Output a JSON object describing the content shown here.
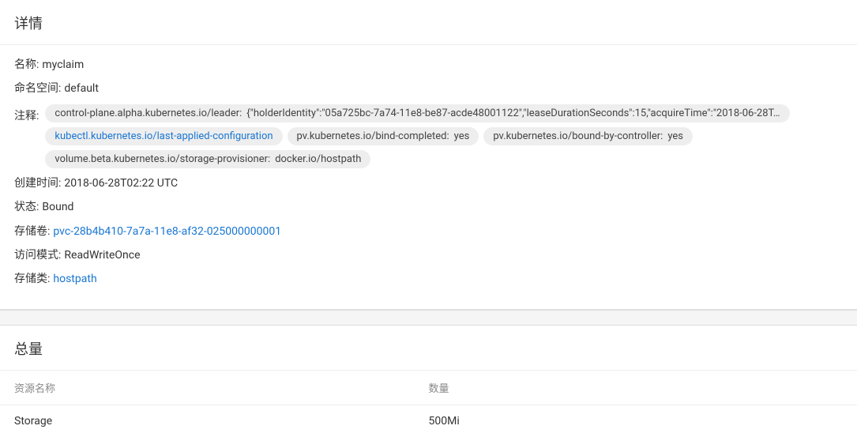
{
  "details": {
    "title": "详情",
    "name_label": "名称:",
    "name_value": "myclaim",
    "namespace_label": "命名空间:",
    "namespace_value": "default",
    "annotations_label": "注释:",
    "annotations": [
      {
        "key": "control-plane.alpha.kubernetes.io/leader:",
        "value": "{\"holderIdentity\":\"05a725bc-7a74-11e8-be87-acde48001122\",\"leaseDurationSeconds\":15,\"acquireTime\":\"2018-06-28T…",
        "link": false,
        "has_value": true
      },
      {
        "key": "kubectl.kubernetes.io/last-applied-configuration",
        "value": "",
        "link": true,
        "has_value": false
      },
      {
        "key": "pv.kubernetes.io/bind-completed:",
        "value": "yes",
        "link": false,
        "has_value": true
      },
      {
        "key": "pv.kubernetes.io/bound-by-controller:",
        "value": "yes",
        "link": false,
        "has_value": true
      },
      {
        "key": "volume.beta.kubernetes.io/storage-provisioner:",
        "value": "docker.io/hostpath",
        "link": false,
        "has_value": true
      }
    ],
    "created_label": "创建时间:",
    "created_value": "2018-06-28T02:22 UTC",
    "status_label": "状态:",
    "status_value": "Bound",
    "volume_label": "存储卷:",
    "volume_value": "pvc-28b4b410-7a7a-11e8-af32-025000000001",
    "access_label": "访问模式:",
    "access_value": "ReadWriteOnce",
    "storageclass_label": "存储类:",
    "storageclass_value": "hostpath"
  },
  "capacity": {
    "title": "总量",
    "col_name": "资源名称",
    "col_qty": "数量",
    "rows": [
      {
        "name": "Storage",
        "qty": "500Mi"
      }
    ]
  }
}
